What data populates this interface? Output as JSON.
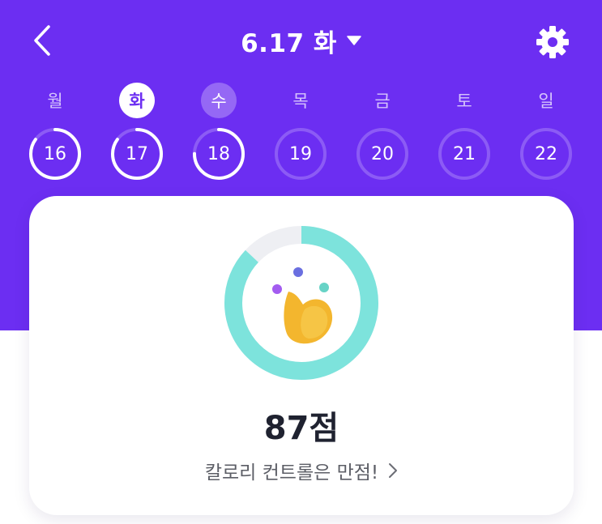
{
  "header": {
    "title": "6.17 화",
    "back_icon": "chevron-left-icon",
    "dropdown_icon": "caret-down-icon",
    "settings_icon": "gear-icon"
  },
  "week": {
    "days": [
      {
        "weekday": "월",
        "date": "16",
        "state": "normal",
        "progress": 0.85
      },
      {
        "weekday": "화",
        "date": "17",
        "state": "selected",
        "progress": 0.85
      },
      {
        "weekday": "수",
        "date": "18",
        "state": "today",
        "progress": 0.75
      },
      {
        "weekday": "목",
        "date": "19",
        "state": "normal",
        "progress": 0
      },
      {
        "weekday": "금",
        "date": "20",
        "state": "normal",
        "progress": 0
      },
      {
        "weekday": "토",
        "date": "21",
        "state": "normal",
        "progress": 0
      },
      {
        "weekday": "일",
        "date": "22",
        "state": "normal",
        "progress": 0
      }
    ]
  },
  "summary": {
    "score": "87점",
    "score_progress": 0.87,
    "message": "칼로리 컨트롤은 만점!",
    "message_icon": "chevron-right-icon"
  },
  "colors": {
    "brand_purple": "#6c2ef2",
    "ring_mint": "#7de3dc",
    "ring_track": "#eeeff3"
  }
}
